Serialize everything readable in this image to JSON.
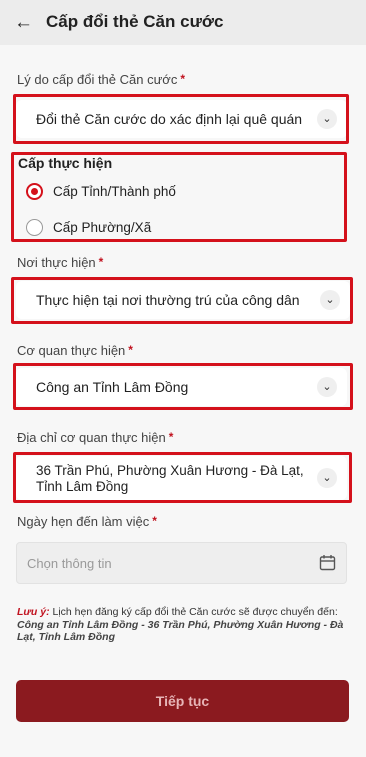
{
  "header": {
    "back_icon": "arrow-left-icon",
    "title": "Cấp đổi thẻ Căn cước"
  },
  "reason": {
    "label": "Lý do cấp đổi thẻ Căn cước",
    "required_mark": "*",
    "value": "Đổi thẻ Căn cước do xác định lại quê quán"
  },
  "level": {
    "title": "Cấp thực hiện",
    "options": [
      {
        "label": "Cấp Tỉnh/Thành phố",
        "selected": true
      },
      {
        "label": "Cấp Phường/Xã",
        "selected": false
      }
    ]
  },
  "place": {
    "label": "Nơi thực hiện",
    "required_mark": "*",
    "value": "Thực hiện tại nơi thường trú của công dân"
  },
  "agency": {
    "label": "Cơ quan thực hiện",
    "required_mark": "*",
    "value": "Công an Tỉnh Lâm Đồng"
  },
  "address": {
    "label": "Địa chỉ cơ quan thực hiện",
    "required_mark": "*",
    "value": "36 Trần Phú, Phường Xuân Hương - Đà Lạt, Tỉnh Lâm Đồng"
  },
  "appointment": {
    "label": "Ngày hẹn đến làm việc",
    "required_mark": "*",
    "placeholder": "Chọn thông tin",
    "icon": "calendar-icon"
  },
  "note": {
    "prefix": "Lưu ý:",
    "text": " Lịch hẹn đăng ký cấp đổi thẻ Căn cước sẽ được chuyển đến: ",
    "bold": "Công an Tỉnh Lâm Đồng - 36 Trần Phú, Phường Xuân Hương - Đà Lạt, Tỉnh Lâm Đồng"
  },
  "submit_label": "Tiếp tục",
  "colors": {
    "accent": "#d4111b",
    "button": "#8b1a1f",
    "highlight": "#d4111b"
  }
}
